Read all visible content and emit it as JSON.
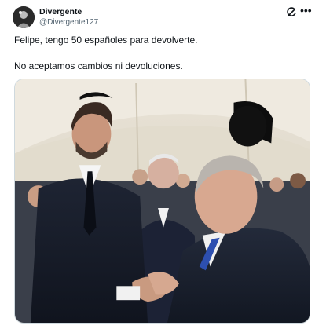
{
  "tweet": {
    "display_name": "Divergente",
    "handle": "@Divergente127",
    "text_line1": "Felipe, tengo 50 españoles para devolverte.",
    "text_line2": "No aceptamos cambios ni devoluciones."
  },
  "icons": {
    "grok": "grok-icon",
    "more": "more-icon",
    "avatar": "avatar"
  },
  "colors": {
    "text_primary": "#0f1419",
    "text_secondary": "#536471",
    "border": "#cfd9de"
  }
}
